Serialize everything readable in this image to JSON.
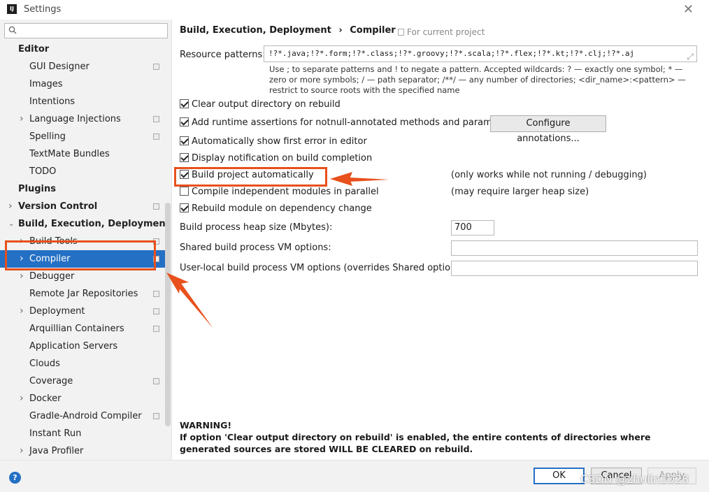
{
  "window": {
    "title": "Settings",
    "app_icon": "IJ"
  },
  "sidebar": {
    "search_placeholder": "",
    "items": [
      {
        "label": "Editor",
        "bold": true,
        "indent": 0,
        "chevron": "none",
        "proj": false
      },
      {
        "label": "GUI Designer",
        "indent": 1,
        "chevron": "none",
        "proj": true
      },
      {
        "label": "Images",
        "indent": 1,
        "chevron": "none",
        "proj": false
      },
      {
        "label": "Intentions",
        "indent": 1,
        "chevron": "none",
        "proj": false
      },
      {
        "label": "Language Injections",
        "indent": 1,
        "chevron": "right",
        "proj": true
      },
      {
        "label": "Spelling",
        "indent": 1,
        "chevron": "none",
        "proj": true
      },
      {
        "label": "TextMate Bundles",
        "indent": 1,
        "chevron": "none",
        "proj": false
      },
      {
        "label": "TODO",
        "indent": 1,
        "chevron": "none",
        "proj": false
      },
      {
        "label": "Plugins",
        "bold": true,
        "indent": 0,
        "chevron": "none",
        "proj": false
      },
      {
        "label": "Version Control",
        "bold": true,
        "indent": 0,
        "chevron": "right",
        "proj": true
      },
      {
        "label": "Build, Execution, Deployment",
        "bold": true,
        "indent": 0,
        "chevron": "down",
        "proj": false
      },
      {
        "label": "Build Tools",
        "indent": 1,
        "chevron": "right",
        "proj": true
      },
      {
        "label": "Compiler",
        "indent": 1,
        "chevron": "right",
        "proj": true,
        "selected": true
      },
      {
        "label": "Debugger",
        "indent": 1,
        "chevron": "right",
        "proj": false
      },
      {
        "label": "Remote Jar Repositories",
        "indent": 1,
        "chevron": "none",
        "proj": true
      },
      {
        "label": "Deployment",
        "indent": 1,
        "chevron": "right",
        "proj": true
      },
      {
        "label": "Arquillian Containers",
        "indent": 1,
        "chevron": "none",
        "proj": true
      },
      {
        "label": "Application Servers",
        "indent": 1,
        "chevron": "none",
        "proj": false
      },
      {
        "label": "Clouds",
        "indent": 1,
        "chevron": "none",
        "proj": false
      },
      {
        "label": "Coverage",
        "indent": 1,
        "chevron": "none",
        "proj": true
      },
      {
        "label": "Docker",
        "indent": 1,
        "chevron": "right",
        "proj": false
      },
      {
        "label": "Gradle-Android Compiler",
        "indent": 1,
        "chevron": "none",
        "proj": true
      },
      {
        "label": "Instant Run",
        "indent": 1,
        "chevron": "none",
        "proj": false
      },
      {
        "label": "Java Profiler",
        "indent": 1,
        "chevron": "right",
        "proj": false
      }
    ]
  },
  "main": {
    "breadcrumb": [
      "Build, Execution, Deployment",
      "›",
      "Compiler"
    ],
    "for_current_project": "For current project",
    "resource_patterns_label": "Resource patterns:",
    "resource_patterns_value": "!?*.java;!?*.form;!?*.class;!?*.groovy;!?*.scala;!?*.flex;!?*.kt;!?*.clj;!?*.aj",
    "resource_hint": "Use ; to separate patterns and ! to negate a pattern. Accepted wildcards: ? — exactly one symbol; * — zero or more symbols; / — path separator; /**/ — any number of directories; <dir_name>:<pattern> — restrict to source roots with the specified name",
    "checkboxes": [
      {
        "label": "Clear output directory on rebuild",
        "checked": true
      },
      {
        "label": "Add runtime assertions for notnull-annotated methods and parameters",
        "checked": true
      },
      {
        "label": "Automatically show first error in editor",
        "checked": true
      },
      {
        "label": "Display notification on build completion",
        "checked": true
      },
      {
        "label": "Build project automatically",
        "checked": true,
        "note": "(only works while not running / debugging)"
      },
      {
        "label": "Compile independent modules in parallel",
        "checked": false,
        "note": "(may require larger heap size)"
      },
      {
        "label": "Rebuild module on dependency change",
        "checked": true
      }
    ],
    "configure_annotations_label": "Configure annotations...",
    "heap_label": "Build process heap size (Mbytes):",
    "heap_value": "700",
    "shared_vm_label": "Shared build process VM options:",
    "shared_vm_value": "",
    "user_vm_label": "User-local build process VM options (overrides Shared options):",
    "user_vm_value": "",
    "warning_title": "WARNING!",
    "warning_text": "If option 'Clear output directory on rebuild' is enabled, the entire contents of directories where generated sources are stored WILL BE CLEARED on rebuild."
  },
  "footer": {
    "help": "?",
    "ok_label": "OK",
    "cancel_label": "Cancel",
    "apply_label": "Apply"
  },
  "watermark": "CSDN @zhulin1028",
  "colors": {
    "selection": "#2470c4",
    "annotation": "#e8501c"
  }
}
